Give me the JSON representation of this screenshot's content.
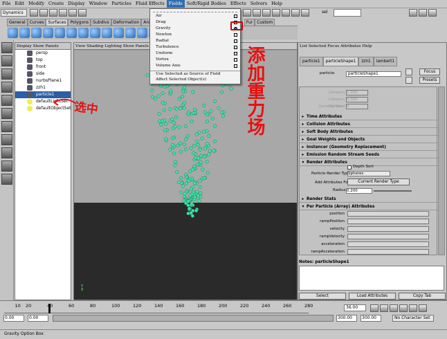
{
  "menubar": [
    "File",
    "Edit",
    "Modify",
    "Create",
    "Display",
    "Window",
    "Particles",
    "Fluid Effects",
    "Fields",
    "Soft/Rigid Bodies",
    "Effects",
    "Solvers",
    "Help"
  ],
  "mode_select": "Dynamics",
  "sel_label": "sel",
  "shelf_tabs": [
    "General",
    "Curves",
    "Surfaces",
    "Polygons",
    "Subdivs",
    "Deformation",
    "Animation",
    "Fur",
    "Custom"
  ],
  "fields_menu": {
    "items": [
      {
        "label": "Air"
      },
      {
        "label": "Drag"
      },
      {
        "label": "Gravity"
      },
      {
        "label": "Newton"
      },
      {
        "label": "Radial"
      },
      {
        "label": "Turbulence"
      },
      {
        "label": "Uniform"
      },
      {
        "label": "Vortex"
      },
      {
        "label": "Volume Axis"
      }
    ],
    "extra": [
      "Use Selected as Source of Field",
      "Affect Selected Object(s)"
    ]
  },
  "outliner": {
    "header": "Display Show Panels",
    "items": [
      "persp",
      "top",
      "front",
      "side",
      "nurbsPlane1",
      "zzh1",
      "particle1",
      "defaultLightSet",
      "defaultObjectSet"
    ],
    "selected": "particle1"
  },
  "viewport": {
    "header": "View Shading Lighting Show Panels",
    "particle_color": "#44e0a8",
    "axis_label": "Y\nX"
  },
  "attr_editor": {
    "header": "List Selected Focus Attributes Help",
    "tabs": [
      "particle1",
      "particleShape1",
      "zzh1",
      "lambert1"
    ],
    "particle_label": "particle:",
    "particle_value": "particleShape1",
    "focus": "Focus",
    "presets": "Presets",
    "dim_fields": [
      {
        "label": "Lifespan",
        "value": "1.000"
      },
      {
        "label": "Lifespan Random",
        "value": "0.000"
      },
      {
        "label": "General Seed",
        "value": "0"
      }
    ],
    "sections_top": [
      "Time Attributes",
      "Collision Attributes",
      "Soft Body Attributes",
      "Goal Weights and Objects",
      "Instancer (Geometry Replacement)",
      "Emission Random Stream Seeds",
      "Render Attributes"
    ],
    "depth_sort": "Depth Sort",
    "render_type_label": "Particle Render Type",
    "render_type_value": "Spheres",
    "add_attr_label": "Add Attributes For",
    "add_attr_button": "Current Render Type",
    "radius_label": "Radius",
    "radius_value": "0.200",
    "sections_bottom": [
      "Render Stats",
      "Per Particle (Array) Attributes"
    ],
    "per_particle": [
      "position",
      "rampPosition",
      "velocity",
      "rampVelocity",
      "acceleration",
      "rampAcceleration"
    ],
    "notes": "Notes: particleShape1",
    "buttons": [
      "Select",
      "Load Attributes",
      "Copy Tab"
    ]
  },
  "timeline": {
    "ticks": [
      "10",
      "20",
      "40",
      "60",
      "80",
      "100",
      "120",
      "140",
      "160",
      "180",
      "200",
      "220",
      "240",
      "260",
      "280"
    ],
    "current": "36.00",
    "start": "0.00",
    "start2": "0.00",
    "end": "300.00",
    "end2": "300.00",
    "char_set": "No Character Set"
  },
  "help_line": "Gravity Option Box",
  "annotations": {
    "select": "选中",
    "add_gravity": "添加重力场"
  },
  "colors": {
    "accent": "#2c5fa3",
    "annotation": "#e81010"
  }
}
